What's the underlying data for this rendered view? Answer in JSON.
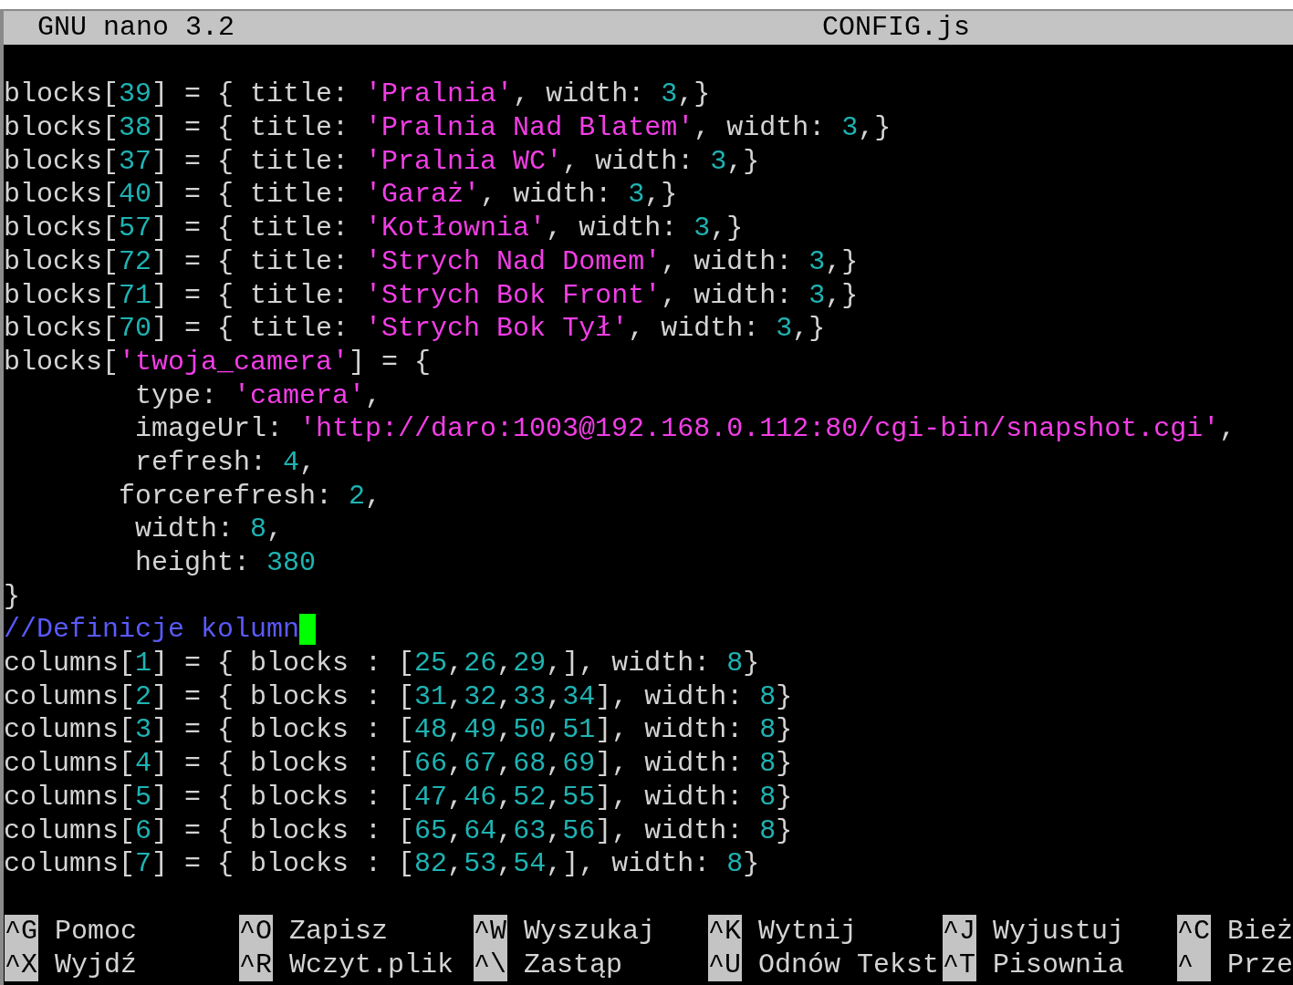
{
  "title_bar": {
    "app": "GNU nano 3.2",
    "file": "CONFIG.js"
  },
  "lines": [
    {
      "cursor": false,
      "tokens": [
        {
          "kind": "plain",
          "text": "blocks["
        },
        {
          "kind": "number",
          "text": "39"
        },
        {
          "kind": "plain",
          "text": "] = { title: "
        },
        {
          "kind": "string",
          "text": "'Pralnia'"
        },
        {
          "kind": "plain",
          "text": ", width: "
        },
        {
          "kind": "number",
          "text": "3"
        },
        {
          "kind": "plain",
          "text": ",}"
        }
      ]
    },
    {
      "cursor": false,
      "tokens": [
        {
          "kind": "plain",
          "text": "blocks["
        },
        {
          "kind": "number",
          "text": "38"
        },
        {
          "kind": "plain",
          "text": "] = { title: "
        },
        {
          "kind": "string",
          "text": "'Pralnia Nad Blatem'"
        },
        {
          "kind": "plain",
          "text": ", width: "
        },
        {
          "kind": "number",
          "text": "3"
        },
        {
          "kind": "plain",
          "text": ",}"
        }
      ]
    },
    {
      "cursor": false,
      "tokens": [
        {
          "kind": "plain",
          "text": "blocks["
        },
        {
          "kind": "number",
          "text": "37"
        },
        {
          "kind": "plain",
          "text": "] = { title: "
        },
        {
          "kind": "string",
          "text": "'Pralnia WC'"
        },
        {
          "kind": "plain",
          "text": ", width: "
        },
        {
          "kind": "number",
          "text": "3"
        },
        {
          "kind": "plain",
          "text": ",}"
        }
      ]
    },
    {
      "cursor": false,
      "tokens": [
        {
          "kind": "plain",
          "text": "blocks["
        },
        {
          "kind": "number",
          "text": "40"
        },
        {
          "kind": "plain",
          "text": "] = { title: "
        },
        {
          "kind": "string",
          "text": "'Garaż'"
        },
        {
          "kind": "plain",
          "text": ", width: "
        },
        {
          "kind": "number",
          "text": "3"
        },
        {
          "kind": "plain",
          "text": ",}"
        }
      ]
    },
    {
      "cursor": false,
      "tokens": [
        {
          "kind": "plain",
          "text": "blocks["
        },
        {
          "kind": "number",
          "text": "57"
        },
        {
          "kind": "plain",
          "text": "] = { title: "
        },
        {
          "kind": "string",
          "text": "'Kotłownia'"
        },
        {
          "kind": "plain",
          "text": ", width: "
        },
        {
          "kind": "number",
          "text": "3"
        },
        {
          "kind": "plain",
          "text": ",}"
        }
      ]
    },
    {
      "cursor": false,
      "tokens": [
        {
          "kind": "plain",
          "text": "blocks["
        },
        {
          "kind": "number",
          "text": "72"
        },
        {
          "kind": "plain",
          "text": "] = { title: "
        },
        {
          "kind": "string",
          "text": "'Strych Nad Domem'"
        },
        {
          "kind": "plain",
          "text": ", width: "
        },
        {
          "kind": "number",
          "text": "3"
        },
        {
          "kind": "plain",
          "text": ",}"
        }
      ]
    },
    {
      "cursor": false,
      "tokens": [
        {
          "kind": "plain",
          "text": "blocks["
        },
        {
          "kind": "number",
          "text": "71"
        },
        {
          "kind": "plain",
          "text": "] = { title: "
        },
        {
          "kind": "string",
          "text": "'Strych Bok Front'"
        },
        {
          "kind": "plain",
          "text": ", width: "
        },
        {
          "kind": "number",
          "text": "3"
        },
        {
          "kind": "plain",
          "text": ",}"
        }
      ]
    },
    {
      "cursor": false,
      "tokens": [
        {
          "kind": "plain",
          "text": "blocks["
        },
        {
          "kind": "number",
          "text": "70"
        },
        {
          "kind": "plain",
          "text": "] = { title: "
        },
        {
          "kind": "string",
          "text": "'Strych Bok Tył'"
        },
        {
          "kind": "plain",
          "text": ", width: "
        },
        {
          "kind": "number",
          "text": "3"
        },
        {
          "kind": "plain",
          "text": ",}"
        }
      ]
    },
    {
      "cursor": false,
      "tokens": [
        {
          "kind": "plain",
          "text": "blocks["
        },
        {
          "kind": "string",
          "text": "'twoja_camera'"
        },
        {
          "kind": "plain",
          "text": "] = {"
        }
      ]
    },
    {
      "cursor": false,
      "tokens": [
        {
          "kind": "plain",
          "text": "        type: "
        },
        {
          "kind": "string",
          "text": "'camera'"
        },
        {
          "kind": "plain",
          "text": ","
        }
      ]
    },
    {
      "cursor": false,
      "tokens": [
        {
          "kind": "plain",
          "text": "        imageUrl: "
        },
        {
          "kind": "string",
          "text": "'http://daro:1003@192.168.0.112:80/cgi-bin/snapshot.cgi'"
        },
        {
          "kind": "plain",
          "text": ","
        }
      ]
    },
    {
      "cursor": false,
      "tokens": [
        {
          "kind": "plain",
          "text": "        refresh: "
        },
        {
          "kind": "number",
          "text": "4"
        },
        {
          "kind": "plain",
          "text": ","
        }
      ]
    },
    {
      "cursor": false,
      "tokens": [
        {
          "kind": "plain",
          "text": "       forcerefresh: "
        },
        {
          "kind": "number",
          "text": "2"
        },
        {
          "kind": "plain",
          "text": ","
        }
      ]
    },
    {
      "cursor": false,
      "tokens": [
        {
          "kind": "plain",
          "text": "        width: "
        },
        {
          "kind": "number",
          "text": "8"
        },
        {
          "kind": "plain",
          "text": ","
        }
      ]
    },
    {
      "cursor": false,
      "tokens": [
        {
          "kind": "plain",
          "text": "        height: "
        },
        {
          "kind": "number",
          "text": "380"
        }
      ]
    },
    {
      "cursor": false,
      "tokens": [
        {
          "kind": "plain",
          "text": "}"
        }
      ]
    },
    {
      "cursor": true,
      "tokens": [
        {
          "kind": "comment",
          "text": "//Definicje kolumn"
        }
      ]
    },
    {
      "cursor": false,
      "tokens": [
        {
          "kind": "plain",
          "text": "columns["
        },
        {
          "kind": "number",
          "text": "1"
        },
        {
          "kind": "plain",
          "text": "] = { blocks : ["
        },
        {
          "kind": "number",
          "text": "25"
        },
        {
          "kind": "plain",
          "text": ","
        },
        {
          "kind": "number",
          "text": "26"
        },
        {
          "kind": "plain",
          "text": ","
        },
        {
          "kind": "number",
          "text": "29"
        },
        {
          "kind": "plain",
          "text": ",], width: "
        },
        {
          "kind": "number",
          "text": "8"
        },
        {
          "kind": "plain",
          "text": "}"
        }
      ]
    },
    {
      "cursor": false,
      "tokens": [
        {
          "kind": "plain",
          "text": "columns["
        },
        {
          "kind": "number",
          "text": "2"
        },
        {
          "kind": "plain",
          "text": "] = { blocks : ["
        },
        {
          "kind": "number",
          "text": "31"
        },
        {
          "kind": "plain",
          "text": ","
        },
        {
          "kind": "number",
          "text": "32"
        },
        {
          "kind": "plain",
          "text": ","
        },
        {
          "kind": "number",
          "text": "33"
        },
        {
          "kind": "plain",
          "text": ","
        },
        {
          "kind": "number",
          "text": "34"
        },
        {
          "kind": "plain",
          "text": "], width: "
        },
        {
          "kind": "number",
          "text": "8"
        },
        {
          "kind": "plain",
          "text": "}"
        }
      ]
    },
    {
      "cursor": false,
      "tokens": [
        {
          "kind": "plain",
          "text": "columns["
        },
        {
          "kind": "number",
          "text": "3"
        },
        {
          "kind": "plain",
          "text": "] = { blocks : ["
        },
        {
          "kind": "number",
          "text": "48"
        },
        {
          "kind": "plain",
          "text": ","
        },
        {
          "kind": "number",
          "text": "49"
        },
        {
          "kind": "plain",
          "text": ","
        },
        {
          "kind": "number",
          "text": "50"
        },
        {
          "kind": "plain",
          "text": ","
        },
        {
          "kind": "number",
          "text": "51"
        },
        {
          "kind": "plain",
          "text": "], width: "
        },
        {
          "kind": "number",
          "text": "8"
        },
        {
          "kind": "plain",
          "text": "}"
        }
      ]
    },
    {
      "cursor": false,
      "tokens": [
        {
          "kind": "plain",
          "text": "columns["
        },
        {
          "kind": "number",
          "text": "4"
        },
        {
          "kind": "plain",
          "text": "] = { blocks : ["
        },
        {
          "kind": "number",
          "text": "66"
        },
        {
          "kind": "plain",
          "text": ","
        },
        {
          "kind": "number",
          "text": "67"
        },
        {
          "kind": "plain",
          "text": ","
        },
        {
          "kind": "number",
          "text": "68"
        },
        {
          "kind": "plain",
          "text": ","
        },
        {
          "kind": "number",
          "text": "69"
        },
        {
          "kind": "plain",
          "text": "], width: "
        },
        {
          "kind": "number",
          "text": "8"
        },
        {
          "kind": "plain",
          "text": "}"
        }
      ]
    },
    {
      "cursor": false,
      "tokens": [
        {
          "kind": "plain",
          "text": "columns["
        },
        {
          "kind": "number",
          "text": "5"
        },
        {
          "kind": "plain",
          "text": "] = { blocks : ["
        },
        {
          "kind": "number",
          "text": "47"
        },
        {
          "kind": "plain",
          "text": ","
        },
        {
          "kind": "number",
          "text": "46"
        },
        {
          "kind": "plain",
          "text": ","
        },
        {
          "kind": "number",
          "text": "52"
        },
        {
          "kind": "plain",
          "text": ","
        },
        {
          "kind": "number",
          "text": "55"
        },
        {
          "kind": "plain",
          "text": "], width: "
        },
        {
          "kind": "number",
          "text": "8"
        },
        {
          "kind": "plain",
          "text": "}"
        }
      ]
    },
    {
      "cursor": false,
      "tokens": [
        {
          "kind": "plain",
          "text": "columns["
        },
        {
          "kind": "number",
          "text": "6"
        },
        {
          "kind": "plain",
          "text": "] = { blocks : ["
        },
        {
          "kind": "number",
          "text": "65"
        },
        {
          "kind": "plain",
          "text": ","
        },
        {
          "kind": "number",
          "text": "64"
        },
        {
          "kind": "plain",
          "text": ","
        },
        {
          "kind": "number",
          "text": "63"
        },
        {
          "kind": "plain",
          "text": ","
        },
        {
          "kind": "number",
          "text": "56"
        },
        {
          "kind": "plain",
          "text": "], width: "
        },
        {
          "kind": "number",
          "text": "8"
        },
        {
          "kind": "plain",
          "text": "}"
        }
      ]
    },
    {
      "cursor": false,
      "tokens": [
        {
          "kind": "plain",
          "text": "columns["
        },
        {
          "kind": "number",
          "text": "7"
        },
        {
          "kind": "plain",
          "text": "] = { blocks : ["
        },
        {
          "kind": "number",
          "text": "82"
        },
        {
          "kind": "plain",
          "text": ","
        },
        {
          "kind": "number",
          "text": "53"
        },
        {
          "kind": "plain",
          "text": ","
        },
        {
          "kind": "number",
          "text": "54"
        },
        {
          "kind": "plain",
          "text": ",], width: "
        },
        {
          "kind": "number",
          "text": "8"
        },
        {
          "kind": "plain",
          "text": "}"
        }
      ]
    }
  ],
  "shortcuts": [
    {
      "key": "^G",
      "label": "Pomoc"
    },
    {
      "key": "^O",
      "label": "Zapisz"
    },
    {
      "key": "^W",
      "label": "Wyszukaj"
    },
    {
      "key": "^K",
      "label": "Wytnij"
    },
    {
      "key": "^J",
      "label": "Wyjustuj"
    },
    {
      "key": "^C",
      "label": "Bież"
    },
    {
      "key": "^X",
      "label": "Wyjdź"
    },
    {
      "key": "^R",
      "label": "Wczyt.plik"
    },
    {
      "key": "^\\",
      "label": "Zastąp"
    },
    {
      "key": "^U",
      "label": "Odnów Tekst"
    },
    {
      "key": "^T",
      "label": "Pisownia"
    },
    {
      "key": "^",
      "label": "Prze"
    }
  ]
}
